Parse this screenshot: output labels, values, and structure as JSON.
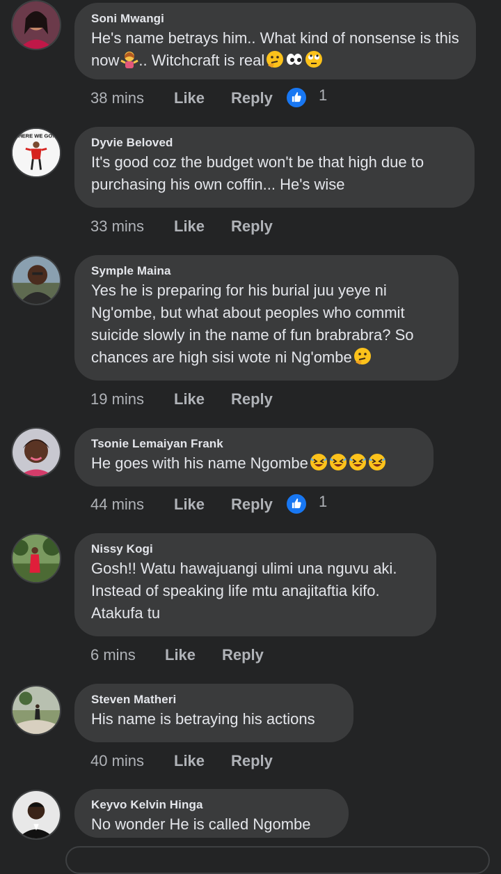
{
  "comments": [
    {
      "author": "Soni Mwangi",
      "text": "He's name betrays him.. What kind of nonsense is this now",
      "text_tail": ".. Witchcraft is real",
      "emoji_mid": "woman-shrugging-emoji",
      "emoji_end": [
        "thinking-emoji",
        "eyes-emoji",
        "eye-roll-emoji"
      ],
      "time": "38 mins",
      "like": "Like",
      "reply": "Reply",
      "reaction_count": "1"
    },
    {
      "author": "Dyvie Beloved",
      "avatar_text": "HERE WE GO!",
      "text": "It's good coz the budget won't be that high due to purchasing his own coffin... He's wise",
      "time": "33 mins",
      "like": "Like",
      "reply": "Reply"
    },
    {
      "author": "Symple Maina",
      "text": "Yes he is preparing for his burial juu yeye ni Ng'ombe, but what about peoples who commit suicide slowly in the name of fun brabrabra? So chances are high sisi wote ni Ng'ombe",
      "emoji_end": [
        "thinking-emoji"
      ],
      "time": "19 mins",
      "like": "Like",
      "reply": "Reply"
    },
    {
      "author": "Tsonie Lemaiyan Frank",
      "text": "He goes with his name Ngombe",
      "emoji_end": [
        "rofl-emoji",
        "rofl-emoji",
        "rofl-emoji",
        "rofl-emoji"
      ],
      "time": "44 mins",
      "like": "Like",
      "reply": "Reply",
      "reaction_count": "1"
    },
    {
      "author": "Nissy Kogi",
      "text": "Gosh!! Watu hawajuangi ulimi una nguvu aki. Instead of speaking life mtu anajitaftia kifo. Atakufa tu",
      "time": "6 mins",
      "like": "Like",
      "reply": "Reply"
    },
    {
      "author": "Steven Matheri",
      "text": "His name is betraying his actions",
      "time": "40 mins",
      "like": "Like",
      "reply": "Reply"
    },
    {
      "author": "Keyvo Kelvin Hinga",
      "text": "No wonder He is called Ngombe"
    }
  ],
  "colors": {
    "background": "#232425",
    "bubble": "#3a3b3c",
    "text": "#e4e6eb",
    "secondary": "#b0b3b8",
    "like_blue": "#1877f2"
  }
}
